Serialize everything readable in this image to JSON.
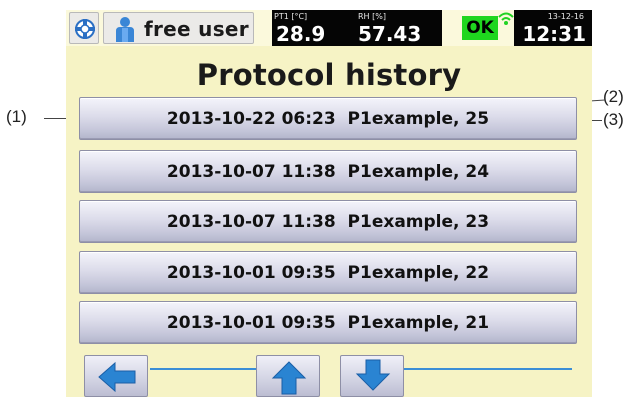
{
  "callouts": {
    "c1": "(1)",
    "c2": "(2)",
    "c3": "(3)"
  },
  "status": {
    "user_label": "free user",
    "pt1_label": "PT1 [°C]",
    "pt1_value": "28.9",
    "rh_label": "RH [%]",
    "rh_value": "57.43",
    "ok_label": "OK",
    "date": "13-12-16",
    "time": "12:31"
  },
  "title": "Protocol history",
  "rows": [
    {
      "label": "2013-10-22 06:23  P1example, 25"
    },
    {
      "label": "2013-10-07 11:38  P1example, 24"
    },
    {
      "label": "2013-10-07 11:38  P1example, 23"
    },
    {
      "label": "2013-10-01 09:35  P1example, 22"
    },
    {
      "label": "2013-10-01 09:35  P1example, 21"
    }
  ],
  "icons": {
    "settings": "settings-icon",
    "user": "user-icon",
    "wifi": "wifi-icon",
    "back": "arrow-left-icon",
    "up": "arrow-up-icon",
    "down": "arrow-down-icon"
  },
  "colors": {
    "screen_bg": "#f6f3c5",
    "ok_green": "#1fd61f",
    "arrow_blue": "#2a84d2",
    "status_black": "#050505"
  }
}
